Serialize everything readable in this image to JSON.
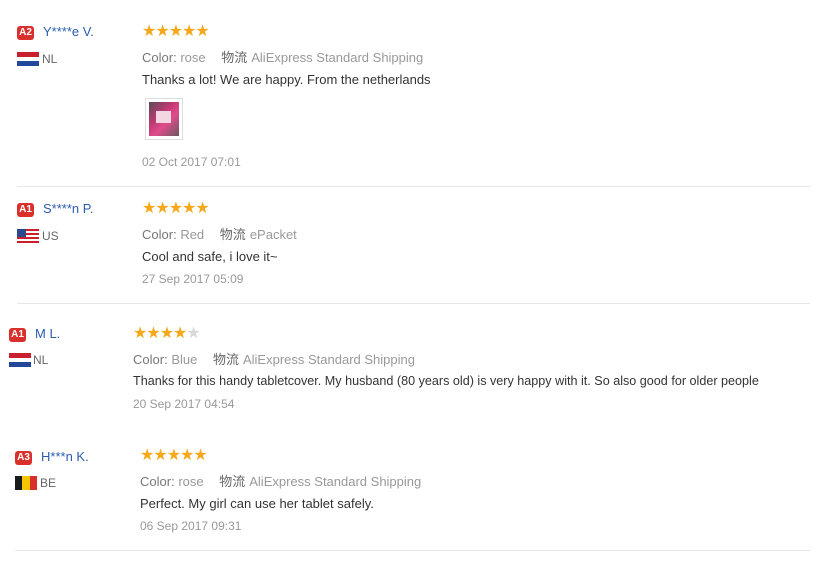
{
  "reviews": [
    {
      "badge": "A2",
      "name": "Y****e V.",
      "country": "NL",
      "flag": "nl",
      "stars": 5,
      "color_label": "Color:",
      "color_value": "rose",
      "shipping_label": "物流",
      "shipping_value": "AliExpress Standard Shipping",
      "text": "Thanks a lot! We are happy. From the netherlands",
      "has_photo": true,
      "date": "02 Oct 2017 07:01"
    },
    {
      "badge": "A1",
      "name": "S****n P.",
      "country": "US",
      "flag": "us",
      "stars": 5,
      "color_label": "Color:",
      "color_value": "Red",
      "shipping_label": "物流",
      "shipping_value": "ePacket",
      "text": "Cool and safe, i love it~",
      "has_photo": false,
      "date": "27 Sep 2017 05:09"
    },
    {
      "badge": "A1",
      "name": "M L.",
      "country": "NL",
      "flag": "nl",
      "stars": 4,
      "color_label": "Color:",
      "color_value": "Blue",
      "shipping_label": "物流",
      "shipping_value": "AliExpress Standard Shipping",
      "text": "Thanks for this handy tabletcover. My husband (80 years old) is very happy with it. So also good for older people",
      "has_photo": false,
      "date": "20 Sep 2017 04:54"
    },
    {
      "badge": "A3",
      "name": "H***n K.",
      "country": "BE",
      "flag": "be",
      "stars": 5,
      "color_label": "Color:",
      "color_value": "rose",
      "shipping_label": "物流",
      "shipping_value": "AliExpress Standard Shipping",
      "text": "Perfect. My girl can use her tablet safely.",
      "has_photo": false,
      "date": "06 Sep 2017 09:31"
    }
  ],
  "colors": {
    "star": "#f6a81b",
    "badge": "#d9302b",
    "name": "#2a5db0"
  }
}
